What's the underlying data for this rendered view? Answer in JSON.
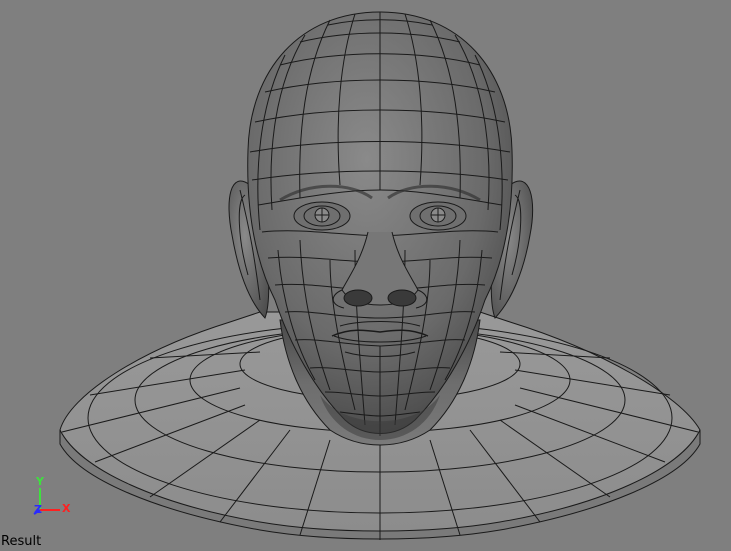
{
  "viewport": {
    "camera_label": "Result",
    "background_color": "#7f7f7f",
    "model": "head-bust-wireframe"
  },
  "axis_gizmo": {
    "y_label": "Y",
    "z_label": "Z",
    "x_label": "X",
    "y_color": "#3ee03e",
    "z_color": "#2a2aff",
    "x_color": "#ff2020"
  }
}
